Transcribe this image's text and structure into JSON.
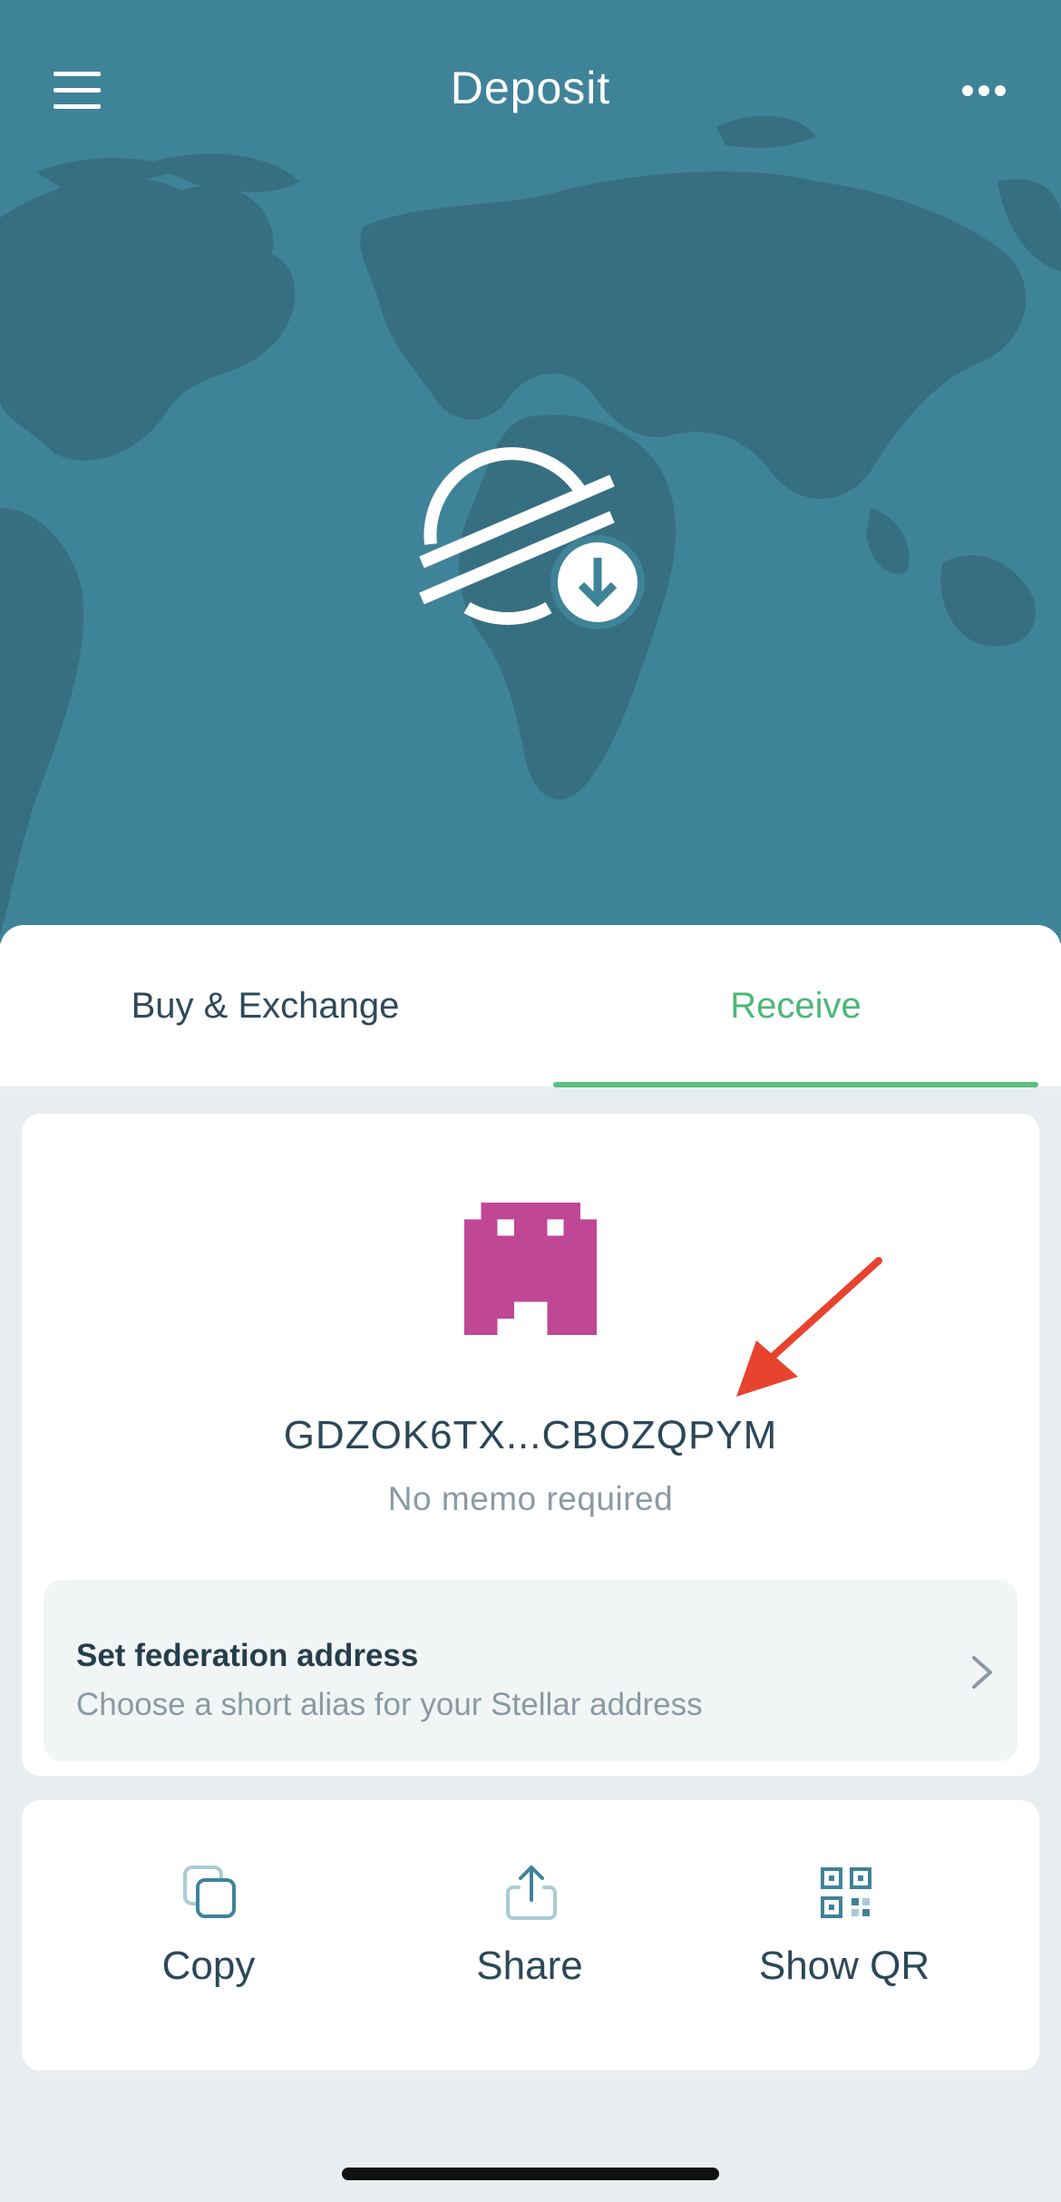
{
  "header": {
    "title": "Deposit",
    "menu_icon": "hamburger-menu-icon",
    "more_icon": "more-horizontal-icon"
  },
  "hero": {
    "logo_icon": "stellar-deposit-icon",
    "background_color": "#3f8399"
  },
  "tabs": [
    {
      "label": "Buy & Exchange",
      "active": false
    },
    {
      "label": "Receive",
      "active": true
    }
  ],
  "account": {
    "avatar_icon": "identicon-avatar",
    "avatar_color": "#c04795",
    "address": "GDZOK6TX...CBOZQPYM",
    "memo_text": "No memo required"
  },
  "federation": {
    "title": "Set federation address",
    "subtitle": "Choose a short alias for your Stellar address"
  },
  "actions": [
    {
      "label": "Copy",
      "icon": "copy-icon"
    },
    {
      "label": "Share",
      "icon": "share-icon"
    },
    {
      "label": "Show QR",
      "icon": "qr-code-icon"
    }
  ],
  "colors": {
    "accent_green": "#4cb877",
    "text_dark": "#2b4858",
    "text_muted": "#8a9aa3",
    "annotation_arrow": "#e8432e"
  }
}
